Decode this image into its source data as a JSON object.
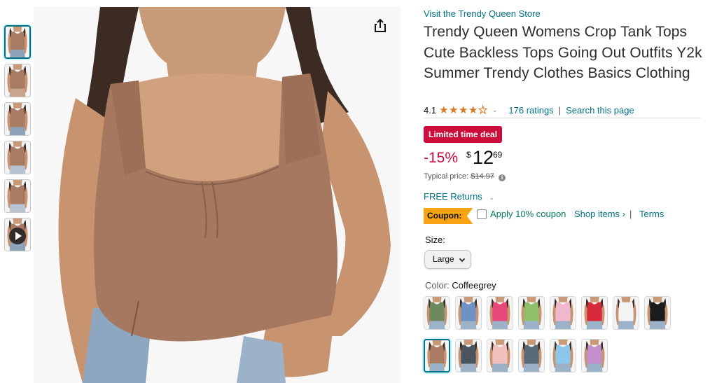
{
  "product": {
    "store_link": "Visit the Trendy Queen Store",
    "title": "Trendy Queen Womens Crop Tank Tops Cute Backless Tops Going Out Outfits Y2k Summer Trendy Clothes Basics Clothing",
    "rating_value": "4.1",
    "rating_stars": 4.1,
    "ratings_count": "176 ratings",
    "search_page": "Search this page",
    "deal_badge": "Limited time deal",
    "discount": "-15%",
    "currency": "$",
    "price_whole": "12",
    "price_fraction": "69",
    "typical_label": "Typical price:",
    "typical_price": "$14.97",
    "returns": "FREE Returns",
    "coupon_badge": "Coupon:",
    "coupon_text": "Apply 10% coupon",
    "shop_items": "Shop items ›",
    "coupon_sep": "|",
    "terms": "Terms",
    "size_label": "Size:",
    "size_selected": "Large",
    "color_label": "Color:",
    "color_selected": "Coffeegrey"
  },
  "colors": {
    "link": "#007185",
    "deal": "#cc0c39",
    "star": "#de7921",
    "coupon": "#f7a313",
    "coupon_text": "#067d62",
    "selected_border": "#007185"
  },
  "thumbnails": [
    {
      "top_color": "#a97b64",
      "bottom_color": "#8fa3b8",
      "selected": true
    },
    {
      "top_color": "#a97b64",
      "bottom_color": "#c9a48c",
      "selected": false
    },
    {
      "top_color": "#a97b64",
      "bottom_color": "#8fa3b8",
      "selected": false
    },
    {
      "top_color": "#a97b64",
      "bottom_color": "#b7c3d0",
      "selected": false
    },
    {
      "top_color": "#a97b64",
      "bottom_color": "#b7c3d0",
      "selected": false
    },
    {
      "top_color": "#a97b64",
      "bottom_color": "#8fa3b8",
      "selected": false,
      "video": true
    }
  ],
  "color_swatches": [
    {
      "color": "#6f8a5a",
      "selected": false
    },
    {
      "color": "#6f92c4",
      "selected": false
    },
    {
      "color": "#e8487a",
      "selected": false
    },
    {
      "color": "#8fc06a",
      "selected": false
    },
    {
      "color": "#f0b8cc",
      "selected": false
    },
    {
      "color": "#d82a3a",
      "selected": false
    },
    {
      "color": "#f4f4f4",
      "selected": false
    },
    {
      "color": "#1c1c1c",
      "selected": false
    },
    {
      "color": "#a97b64",
      "selected": true
    },
    {
      "color": "#4a5560",
      "selected": false
    },
    {
      "color": "#f1c1bf",
      "selected": false
    },
    {
      "color": "#5a6a78",
      "selected": false
    },
    {
      "color": "#8cc6e8",
      "selected": false
    },
    {
      "color": "#c490cc",
      "selected": false
    }
  ]
}
